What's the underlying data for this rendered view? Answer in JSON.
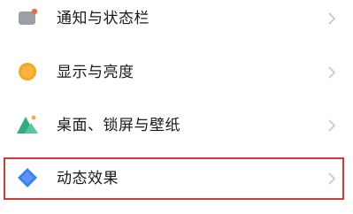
{
  "settings": {
    "items": [
      {
        "label": "通知与状态栏",
        "icon": "notification-card-icon",
        "icon_color": "#9aa0a6",
        "badge_color": "#ee6a4a"
      },
      {
        "label": "显示与亮度",
        "icon": "brightness-sun-icon",
        "icon_color": "#f5a623"
      },
      {
        "label": "桌面、锁屏与壁纸",
        "icon": "wallpaper-mountain-icon",
        "icon_color": "#2fae7e"
      },
      {
        "label": "动态效果",
        "icon": "motion-diamond-icon",
        "icon_color": "#3b7ff2"
      }
    ]
  },
  "colors": {
    "highlight_border": "#d23a3a",
    "chevron": "#c4c4c4",
    "text": "#1a1a1a"
  }
}
